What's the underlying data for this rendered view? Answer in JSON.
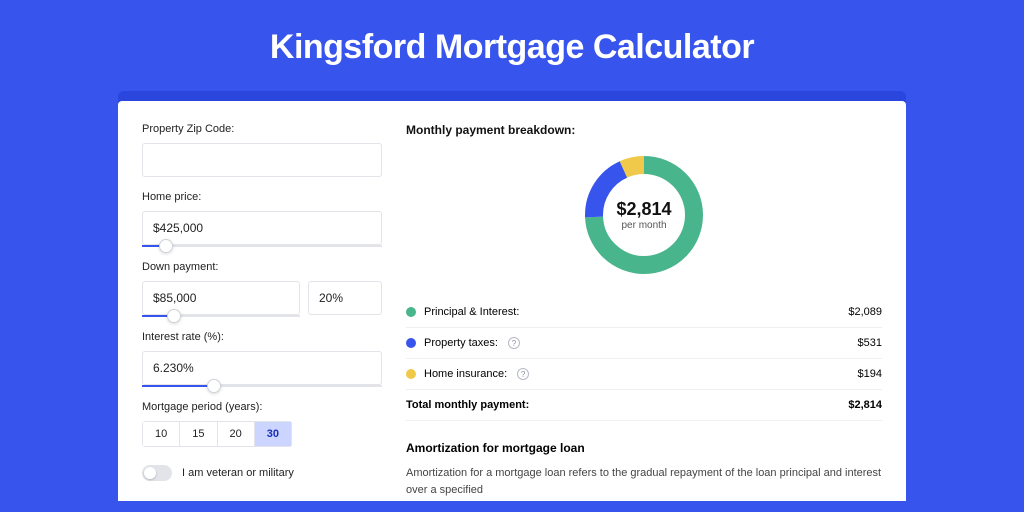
{
  "title": "Kingsford Mortgage Calculator",
  "colors": {
    "principal": "#49b58c",
    "taxes": "#3754ed",
    "insurance": "#f0c94a"
  },
  "form": {
    "zip_label": "Property Zip Code:",
    "zip_value": "",
    "home_price_label": "Home price:",
    "home_price_value": "$425,000",
    "home_price_slider_pct": 10,
    "down_label": "Down payment:",
    "down_value": "$85,000",
    "down_pct_value": "20%",
    "down_slider_pct": 20,
    "rate_label": "Interest rate (%):",
    "rate_value": "6.230%",
    "rate_slider_pct": 30,
    "period_label": "Mortgage period (years):",
    "periods": [
      "10",
      "15",
      "20",
      "30"
    ],
    "period_active": "30",
    "veteran_label": "I am veteran or military"
  },
  "chart_data": {
    "type": "pie",
    "title": "Monthly payment breakdown:",
    "center_value": "$2,814",
    "center_sub": "per month",
    "series": [
      {
        "name": "Principal & Interest:",
        "value": 2089,
        "display": "$2,089",
        "color": "#49b58c",
        "info": false
      },
      {
        "name": "Property taxes:",
        "value": 531,
        "display": "$531",
        "color": "#3754ed",
        "info": true
      },
      {
        "name": "Home insurance:",
        "value": 194,
        "display": "$194",
        "color": "#f0c94a",
        "info": true
      }
    ],
    "total_label": "Total monthly payment:",
    "total_display": "$2,814"
  },
  "amort": {
    "title": "Amortization for mortgage loan",
    "text": "Amortization for a mortgage loan refers to the gradual repayment of the loan principal and interest over a specified"
  }
}
